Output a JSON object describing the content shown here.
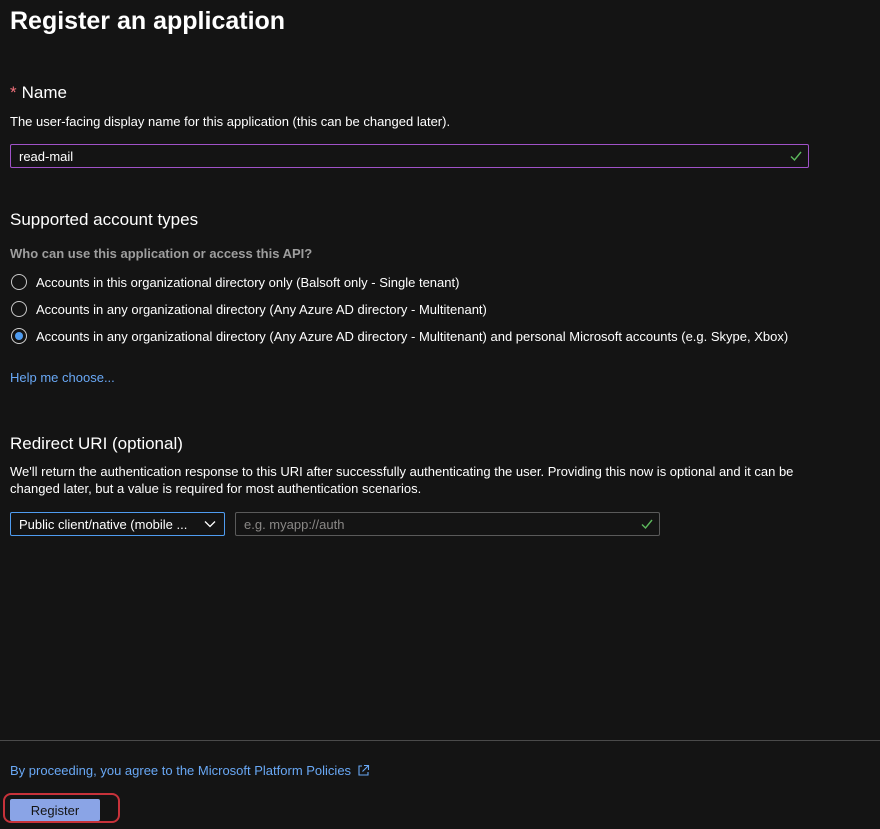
{
  "page": {
    "title": "Register an application"
  },
  "name_section": {
    "required_marker": "*",
    "heading": "Name",
    "description": "The user-facing display name for this application (this can be changed later).",
    "value": "read-mail",
    "valid_icon": "check-icon"
  },
  "account_types": {
    "heading": "Supported account types",
    "question": "Who can use this application or access this API?",
    "options": [
      {
        "label": "Accounts in this organizational directory only (Balsoft only - Single tenant)",
        "selected": false
      },
      {
        "label": "Accounts in any organizational directory (Any Azure AD directory - Multitenant)",
        "selected": false
      },
      {
        "label": "Accounts in any organizational directory (Any Azure AD directory - Multitenant) and personal Microsoft accounts (e.g. Skype, Xbox)",
        "selected": true
      }
    ],
    "help_link": "Help me choose..."
  },
  "redirect_uri": {
    "heading": "Redirect URI (optional)",
    "description": "We'll return the authentication response to this URI after successfully authenticating the user. Providing this now is optional and it can be changed later, but a value is required for most authentication scenarios.",
    "platform_selected": "Public client/native (mobile ...",
    "uri_value": "",
    "uri_placeholder": "e.g. myapp://auth"
  },
  "footer": {
    "policy_text": "By proceeding, you agree to the Microsoft Platform Policies",
    "register_label": "Register"
  },
  "colors": {
    "background": "#141414",
    "link": "#69a8f5",
    "accent_blue": "#4f9cf0",
    "name_input_border": "#a052c8",
    "check_green": "#5cb85c",
    "register_bg": "#8aa4e6",
    "highlight_red": "#c8323a",
    "required_star": "#f1707b"
  }
}
